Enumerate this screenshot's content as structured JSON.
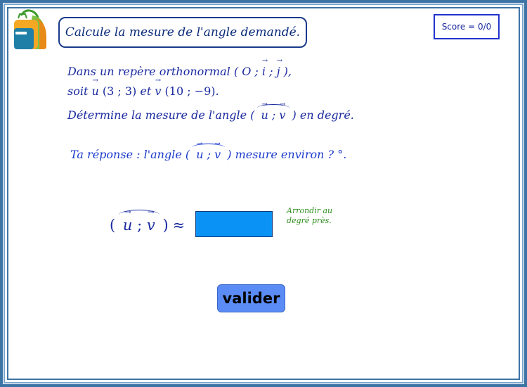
{
  "header": {
    "title": "Calcule la mesure de l'angle demandé.",
    "score_label": "Score = 0/0"
  },
  "statement": {
    "line1_prefix": "Dans un repère orthonormal (",
    "line1_O": "O",
    "line1_sep1": ";",
    "line1_i": "i",
    "line1_sep2": ";",
    "line1_j": "j",
    "line1_suffix": "),",
    "line2_prefix": "soit",
    "line2_u": "u",
    "line2_u_coords": "(3 ; 3)",
    "line2_et": "et",
    "line2_v": "v",
    "line2_v_coords": "(10 ; −9).",
    "line3_prefix": "Détermine la mesure de l'angle (",
    "line3_u": "u",
    "line3_sep": ";",
    "line3_v": "v",
    "line3_suffix": ") en degré.",
    "line4_prefix": "Ta réponse : l'angle (",
    "line4_u": "u",
    "line4_sep": ";",
    "line4_v": "v",
    "line4_suffix": ") mesure environ ? °."
  },
  "answer": {
    "open": "(",
    "u": "u",
    "sep": ";",
    "v": "v",
    "close": ")",
    "approx": "≈",
    "input_value": "",
    "hint": "Arrondir au degré près."
  },
  "buttons": {
    "validate_label": "valider"
  },
  "colors": {
    "text_blue": "#1a2aa0",
    "input_blue": "#0a93f5",
    "button_blue": "#5b8cf5",
    "hint_green": "#2f8f1f",
    "frame_blue": "#3d74a6"
  },
  "icons": {
    "logo": "backpack-icon"
  }
}
